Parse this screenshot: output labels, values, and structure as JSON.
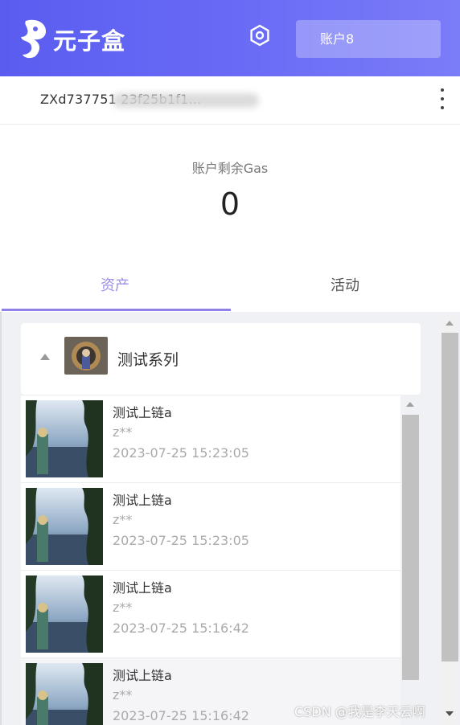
{
  "app": {
    "logo_text": "元子盒",
    "logo_icon": "logo-mark-icon",
    "settings_icon": "settings-hexagon-icon"
  },
  "header": {
    "account_label": "账户8"
  },
  "address": {
    "text": "ZXd737751                              23f25b1f1...",
    "more_icon": "kebab-menu-icon"
  },
  "gas": {
    "label": "账户剩余Gas",
    "value": "0"
  },
  "tabs": [
    {
      "label": "资产",
      "active": true
    },
    {
      "label": "活动",
      "active": false
    }
  ],
  "collection": {
    "name": "测试系列",
    "expand_icon": "caret-up-icon"
  },
  "nfts": [
    {
      "title": "测试上链a",
      "owner": "z**",
      "time": "2023-07-25 15:23:05"
    },
    {
      "title": "测试上链a",
      "owner": "z**",
      "time": "2023-07-25 15:23:05"
    },
    {
      "title": "测试上链a",
      "owner": "z**",
      "time": "2023-07-25 15:16:42"
    },
    {
      "title": "测试上链a",
      "owner": "z**",
      "time": "2023-07-25 15:16:42"
    }
  ],
  "watermark": "CSDN @我是李天云啊",
  "colors": {
    "header_start": "#5a5cf0",
    "header_end": "#7a7cf8",
    "accent": "#8f82e6"
  }
}
